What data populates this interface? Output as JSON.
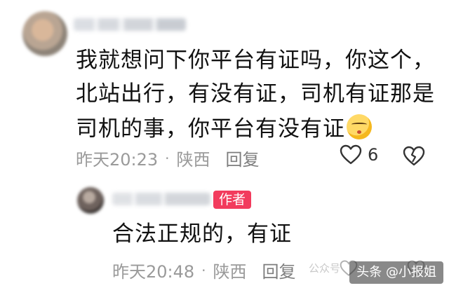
{
  "comment": {
    "lines": [
      "我就想问下你平台有证吗，你这个，",
      "北站出行，有没有证，司机有证那是",
      "司机的事，你平台有没有证"
    ],
    "time": "昨天20:23",
    "separator": "·",
    "location": "陕西",
    "reply_label": "回复",
    "like_count": "6",
    "emoji": "hushed-face-emoji"
  },
  "reply": {
    "author_badge": "作者",
    "text": "合法正规的，有证",
    "time": "昨天20:48",
    "separator": "·",
    "location": "陕西",
    "reply_label": "回复"
  },
  "watermarks": {
    "public_account": "公众号",
    "corner": "头条 @小报姐"
  },
  "colors": {
    "badge": "#f23b5d",
    "meta_text": "#9a9a9a",
    "body_text": "#111111"
  },
  "icons": [
    "heart-icon",
    "broken-heart-icon",
    "hushed-face-emoji"
  ]
}
